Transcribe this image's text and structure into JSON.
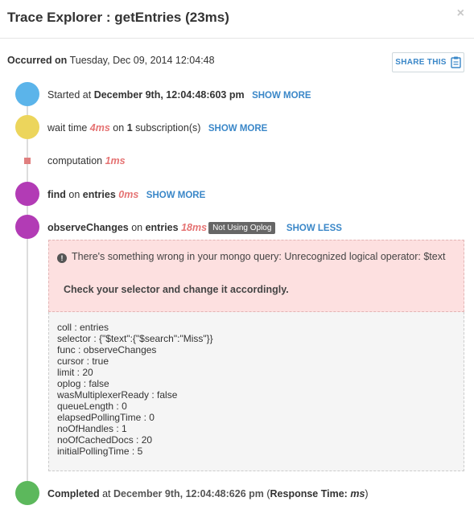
{
  "header": {
    "title": "Trace Explorer : getEntries (23ms)",
    "close_glyph": "×"
  },
  "occurred": {
    "label": "Occurred on",
    "value": "Tuesday, Dec 09, 2014 12:04:48"
  },
  "share": {
    "label": "SHARE THIS",
    "icon": "clipboard-icon"
  },
  "colors": {
    "started": "#5bb4ea",
    "wait": "#ecd55c",
    "computation": "#e07f7f",
    "db": "#b23bb5",
    "completed": "#5cb85c",
    "link": "#3a87c8",
    "time": "#e57373"
  },
  "timeline": {
    "started": {
      "prefix": "Started at ",
      "time": "December 9th, 12:04:48:603 pm",
      "action": "SHOW MORE"
    },
    "wait": {
      "prefix": "wait time ",
      "time": "4ms",
      "mid": " on ",
      "count": "1",
      "suffix": " subscription(s)",
      "action": "SHOW MORE"
    },
    "computation": {
      "label": "computation ",
      "time": "1ms"
    },
    "find": {
      "op": "find",
      "mid": " on ",
      "collection": "entries",
      "time": "0ms",
      "action": "SHOW MORE"
    },
    "observe": {
      "op": "observeChanges",
      "mid": " on ",
      "collection": "entries",
      "time": "18ms",
      "badge": "Not Using Oplog",
      "action": "SHOW LESS",
      "error_message": "There's something wrong in your mongo query: Unrecognized logical operator: $text",
      "error_icon": "!",
      "error_tip": "Check your selector and change it accordingly.",
      "details": [
        "coll : entries",
        "selector : {\"$text\":{\"$search\":\"Miss\"}}",
        "func : observeChanges",
        "cursor : true",
        "limit : 20",
        "oplog : false",
        "wasMultiplexerReady : false",
        "queueLength : 0",
        "elapsedPollingTime : 0",
        "noOfHandles : 1",
        "noOfCachedDocs : 20",
        "initialPollingTime : 5"
      ]
    },
    "completed": {
      "label": "Completed",
      "mid": " at ",
      "time": "December 9th, 12:04:48:626 pm",
      "open": " (",
      "rt_label": "Response Time:",
      "rt_value": "ms",
      "close": ")"
    }
  }
}
